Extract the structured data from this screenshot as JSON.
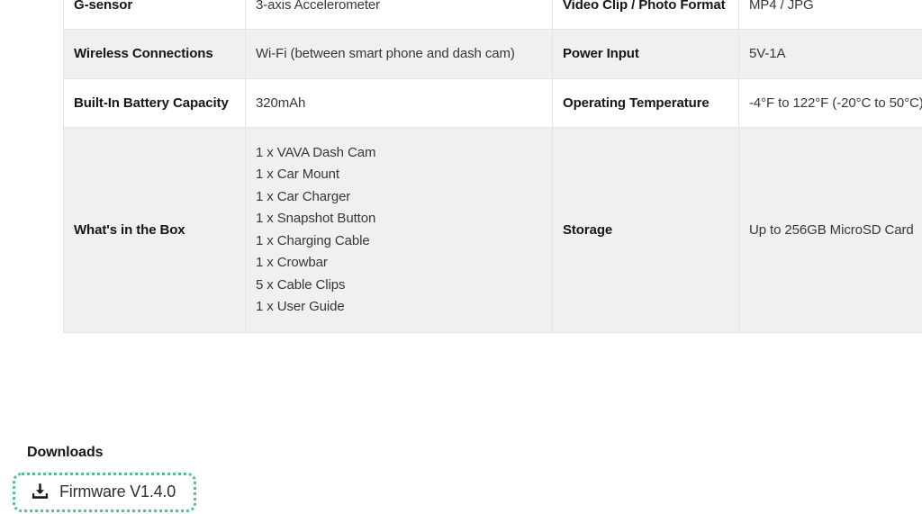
{
  "theme": {
    "page_background": "#ffffff",
    "row_alt_background": "#f0f0f0",
    "border_color": "#e3e4e6",
    "label_color": "#14171a",
    "value_color": "#33383d",
    "focus_outline_color": "#4ec0a0"
  },
  "spec_table": {
    "rows": [
      {
        "label": "G-sensor",
        "value": "3-axis Accelerometer",
        "label2": "Video Clip / Photo Format",
        "value2": "MP4 / JPG"
      },
      {
        "label": "Wireless Connections",
        "value": "Wi-Fi (between smart phone and dash cam)",
        "label2": "Power Input",
        "value2": "5V-1A"
      },
      {
        "label": "Built-In Battery Capacity",
        "value": "320mAh",
        "label2": "Operating Temperature",
        "value2": "-4°F to 122°F (-20°C to 50°C)"
      },
      {
        "label": "What's in the Box",
        "value": "",
        "label2": "Storage",
        "value2": "Up to 256GB MicroSD Card"
      }
    ],
    "box_contents": [
      "1 x VAVA Dash Cam",
      "1 x Car Mount",
      "1 x Car Charger",
      "1 x Snapshot Button",
      "1 x Charging Cable",
      "1 x Crowbar",
      "5 x Cable Clips",
      "1 x User Guide"
    ]
  },
  "downloads": {
    "title": "Downloads",
    "firmware_link_label": "Firmware V1.4.0",
    "firmware_icon": "download-icon"
  }
}
